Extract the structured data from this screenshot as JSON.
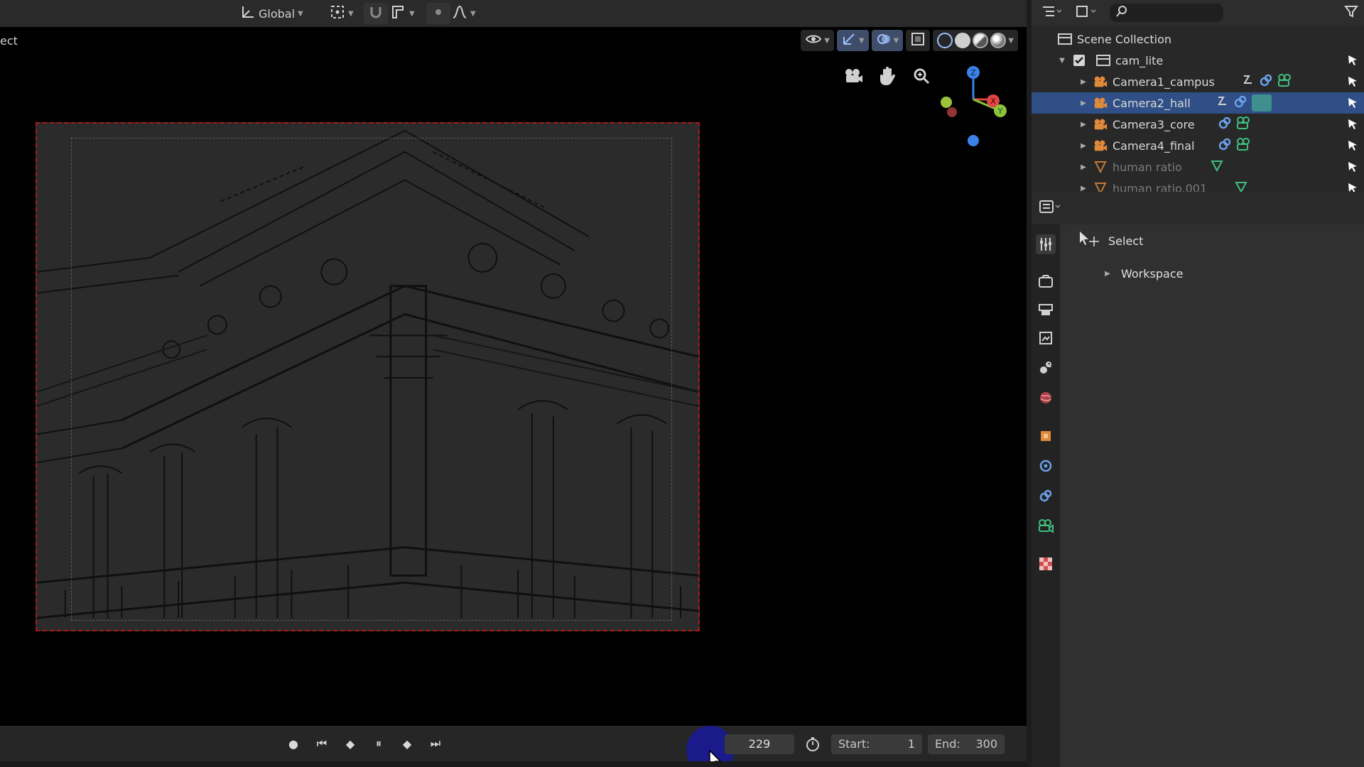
{
  "viewport": {
    "mode_label": "ect",
    "transform_orientation": "Global"
  },
  "outliner": {
    "root": "Scene Collection",
    "collection": "cam_lite",
    "items": [
      {
        "label": "Camera1_campus",
        "selected": false,
        "faded": false
      },
      {
        "label": "Camera2_hall",
        "selected": true,
        "faded": false
      },
      {
        "label": "Camera3_core",
        "selected": false,
        "faded": false
      },
      {
        "label": "Camera4_final",
        "selected": false,
        "faded": false
      },
      {
        "label": "human ratio",
        "selected": false,
        "faded": true
      },
      {
        "label": "human ratio.001",
        "selected": false,
        "faded": true
      }
    ]
  },
  "properties": {
    "active_tool": "Select",
    "panel": "Workspace",
    "tabs": [
      "tool-icon",
      "render-icon",
      "output-icon",
      "view-layer-icon",
      "scene-icon",
      "world-icon",
      "object-icon",
      "modifier-icon",
      "constraint-icon",
      "object-data-camera-icon",
      "texture-icon"
    ]
  },
  "timeline": {
    "current_frame": "229",
    "start_label": "Start:",
    "start_value": "1",
    "end_label": "End:",
    "end_value": "300"
  },
  "colors": {
    "selection": "#2f4f86",
    "camera_orange": "#e08a3c",
    "data_green": "#3fbf7f",
    "constraint_blue": "#6aa0e8",
    "axis_x": "#e04646",
    "axis_y": "#8bc43a",
    "axis_z": "#3a82e8"
  }
}
